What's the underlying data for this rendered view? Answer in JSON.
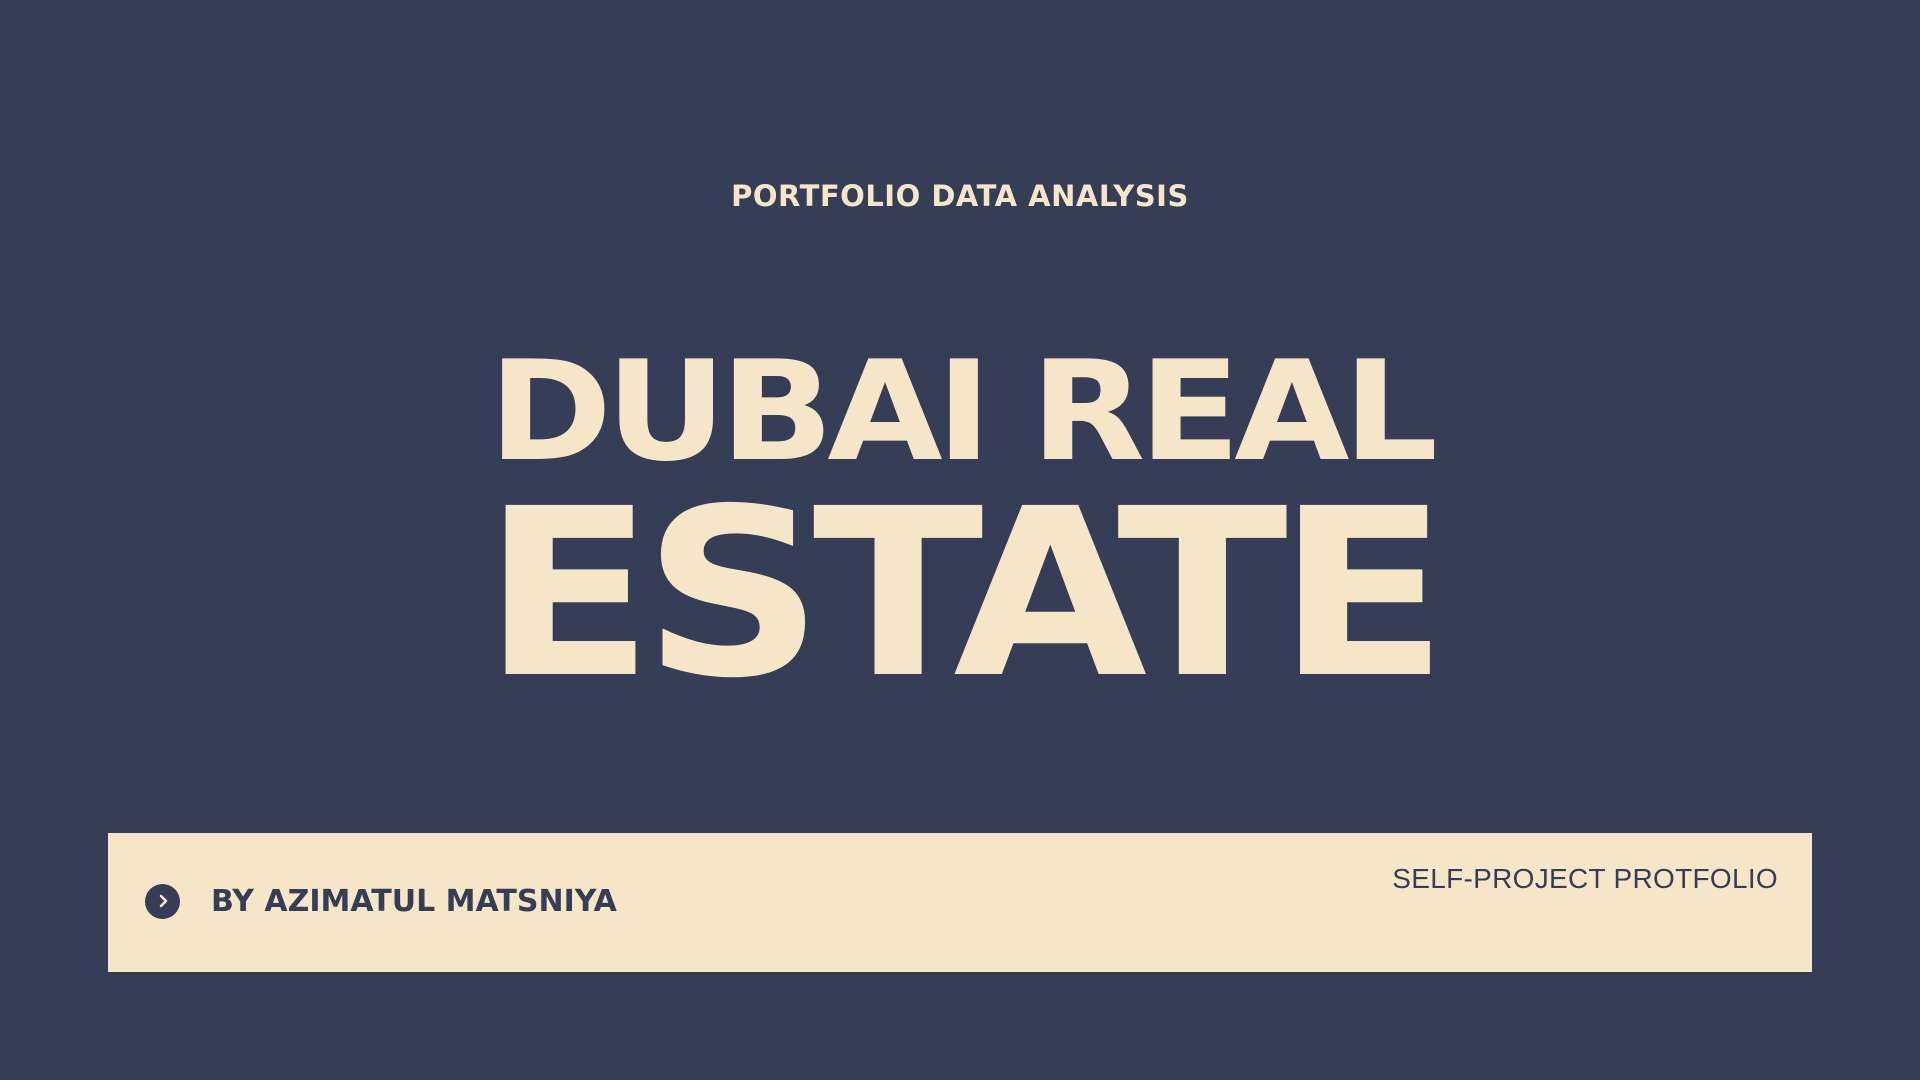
{
  "slide": {
    "kicker": "PORTFOLIO DATA ANALYSIS",
    "title_line1": "DUBAI REAL",
    "title_line2": "ESTATE",
    "author": "BY AZIMATUL MATSNIYA",
    "project_type": "SELF-PROJECT PROTFOLIO",
    "bullet_icon": "chevron-right-circle-icon"
  },
  "colors": {
    "background": "#353E56",
    "accent": "#F6E6C8",
    "text_dark": "#353E56"
  }
}
